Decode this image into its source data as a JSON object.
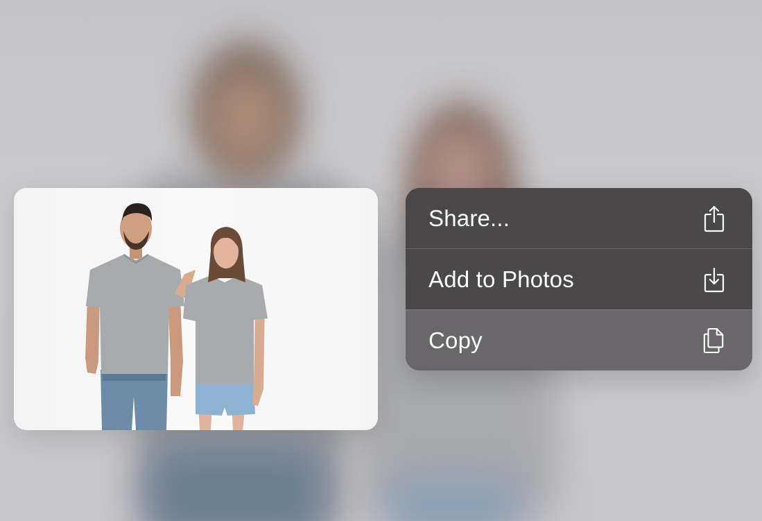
{
  "menu": {
    "items": [
      {
        "label": "Share...",
        "icon": "share-icon"
      },
      {
        "label": "Add to Photos",
        "icon": "save-to-photos-icon"
      },
      {
        "label": "Copy",
        "icon": "copy-icon"
      }
    ]
  },
  "preview": {
    "subject": "photo of a man and a woman in grey t-shirts"
  },
  "colors": {
    "menu_background": "#4a4849",
    "menu_highlight": "#69676a",
    "menu_text": "#ffffff",
    "backdrop": "#c9c8cc"
  }
}
